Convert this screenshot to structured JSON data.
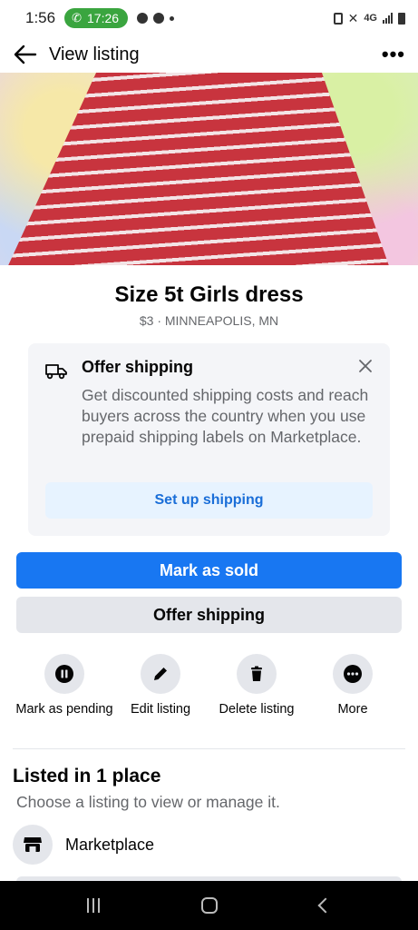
{
  "status_bar": {
    "time": "1:56",
    "call_timer": "17:26",
    "network": "4G"
  },
  "header": {
    "title": "View listing",
    "back_icon": "arrow-left-icon",
    "more_icon": "more-horizontal-icon"
  },
  "listing": {
    "title": "Size 5t Girls dress",
    "subtitle": "$3 · MINNEAPOLIS, MN"
  },
  "shipping_card": {
    "title": "Offer shipping",
    "body": "Get discounted shipping costs and reach buyers across the country when you use prepaid shipping labels on Marketplace.",
    "button_label": "Set up shipping",
    "icon": "truck-icon",
    "close_icon": "close-icon"
  },
  "buttons": {
    "primary_label": "Mark as sold",
    "secondary_label": "Offer shipping"
  },
  "actions": [
    {
      "label": "Mark as pending",
      "icon": "pause-icon"
    },
    {
      "label": "Edit listing",
      "icon": "pencil-icon"
    },
    {
      "label": "Delete listing",
      "icon": "trash-icon"
    },
    {
      "label": "More",
      "icon": "more-horizontal-icon"
    }
  ],
  "places": {
    "title": "Listed in 1 place",
    "subtitle": "Choose a listing to view or manage it.",
    "items": [
      {
        "label": "Marketplace",
        "icon": "storefront-icon"
      }
    ]
  },
  "colors": {
    "primary": "#1877f2",
    "secondary_bg": "#e4e6eb",
    "card_bg": "#f4f5f8",
    "link": "#1a6ed8",
    "muted_text": "#65676b"
  }
}
